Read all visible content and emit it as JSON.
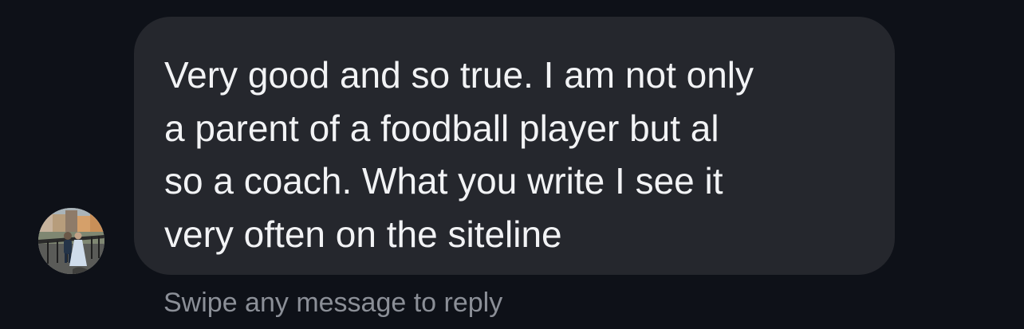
{
  "conversation": {
    "sender_avatar_icon": "profile-photo-icon",
    "message": {
      "lines": [
        "Very good and so true. I am not only",
        "a parent of a foodball player but al",
        "so a coach. What you write I see it",
        "very often on the siteline"
      ]
    },
    "reply_hint": "Swipe any message to reply"
  },
  "colors": {
    "background": "#0e1118",
    "bubble": "#25272d",
    "message_text": "#f2f3f5",
    "hint_text": "#8b8f97"
  }
}
